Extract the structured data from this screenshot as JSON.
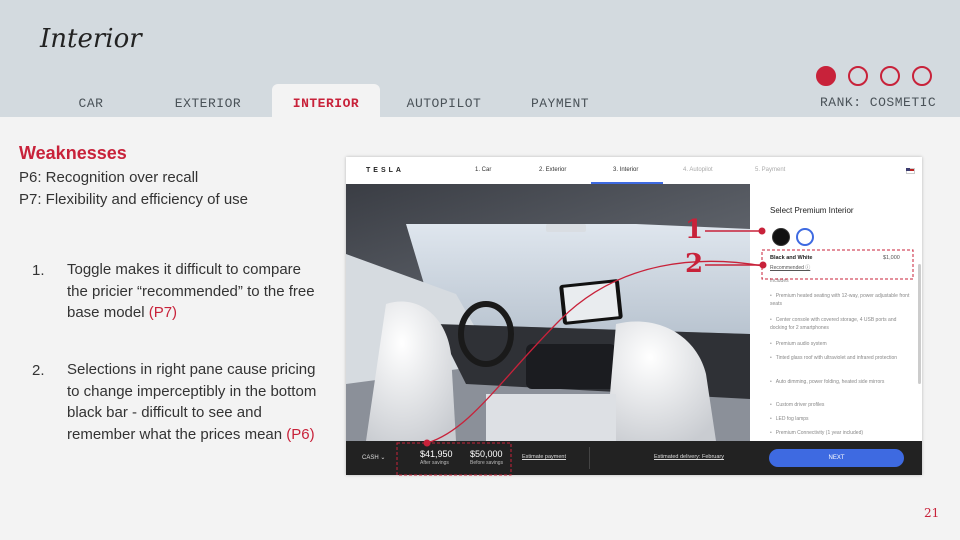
{
  "slide": {
    "title": "Interior",
    "page_number": "21",
    "rank": "RANK: COSMETIC",
    "progress": {
      "filled": 1,
      "total": 4
    },
    "accent_color": "#c8223a"
  },
  "tabs": [
    {
      "label": "CAR",
      "active": false
    },
    {
      "label": "EXTERIOR",
      "active": false
    },
    {
      "label": "INTERIOR",
      "active": true
    },
    {
      "label": "AUTOPILOT",
      "active": false
    },
    {
      "label": "PAYMENT",
      "active": false
    }
  ],
  "weaknesses": {
    "title": "Weaknesses",
    "principles": [
      "P6: Recognition over recall",
      "P7: Flexibility and efficiency of use"
    ],
    "items": [
      {
        "number": "1.",
        "text": "Toggle makes it difficult to compare the pricier “recommended” to the free base model ",
        "ref": "(P7)"
      },
      {
        "number": "2.",
        "text": "Selections in right pane cause pricing to change imperceptibly in the bottom black bar - difficult to see and remember what the prices mean ",
        "ref": "(P6)"
      }
    ]
  },
  "annotations": {
    "one": "1",
    "two": "2"
  },
  "screenshot": {
    "logo": "TESLA",
    "steps": [
      {
        "label": "1. Car",
        "dim": false
      },
      {
        "label": "2. Exterior",
        "dim": false
      },
      {
        "label": "3. Interior",
        "dim": false
      },
      {
        "label": "4. Autopilot",
        "dim": true
      },
      {
        "label": "5. Payment",
        "dim": true
      }
    ],
    "pane": {
      "title": "Select Premium Interior",
      "option_name": "Black and White",
      "option_price": "$1,000",
      "recommended": "Recommended ⓘ",
      "includes": "Includes",
      "features": [
        "Premium heated seating with 12-way, power adjustable front seats",
        "Center console with covered storage, 4 USB ports and docking for 2 smartphones",
        "Premium audio system",
        "Tinted glass roof with ultraviolet and infrared protection",
        "Auto dimming, power folding, heated side mirrors",
        "Custom driver profiles",
        "LED fog lamps",
        "Premium Connectivity (1 year included)"
      ]
    },
    "bottom": {
      "cash": "CASH ⌄",
      "after_price": "$41,950",
      "after_label": "After savings",
      "before_price": "$50,000",
      "before_label": "Before savings",
      "estimate_payment": "Estimate payment",
      "estimated_delivery": "Estimated delivery: February",
      "next": "NEXT"
    }
  }
}
